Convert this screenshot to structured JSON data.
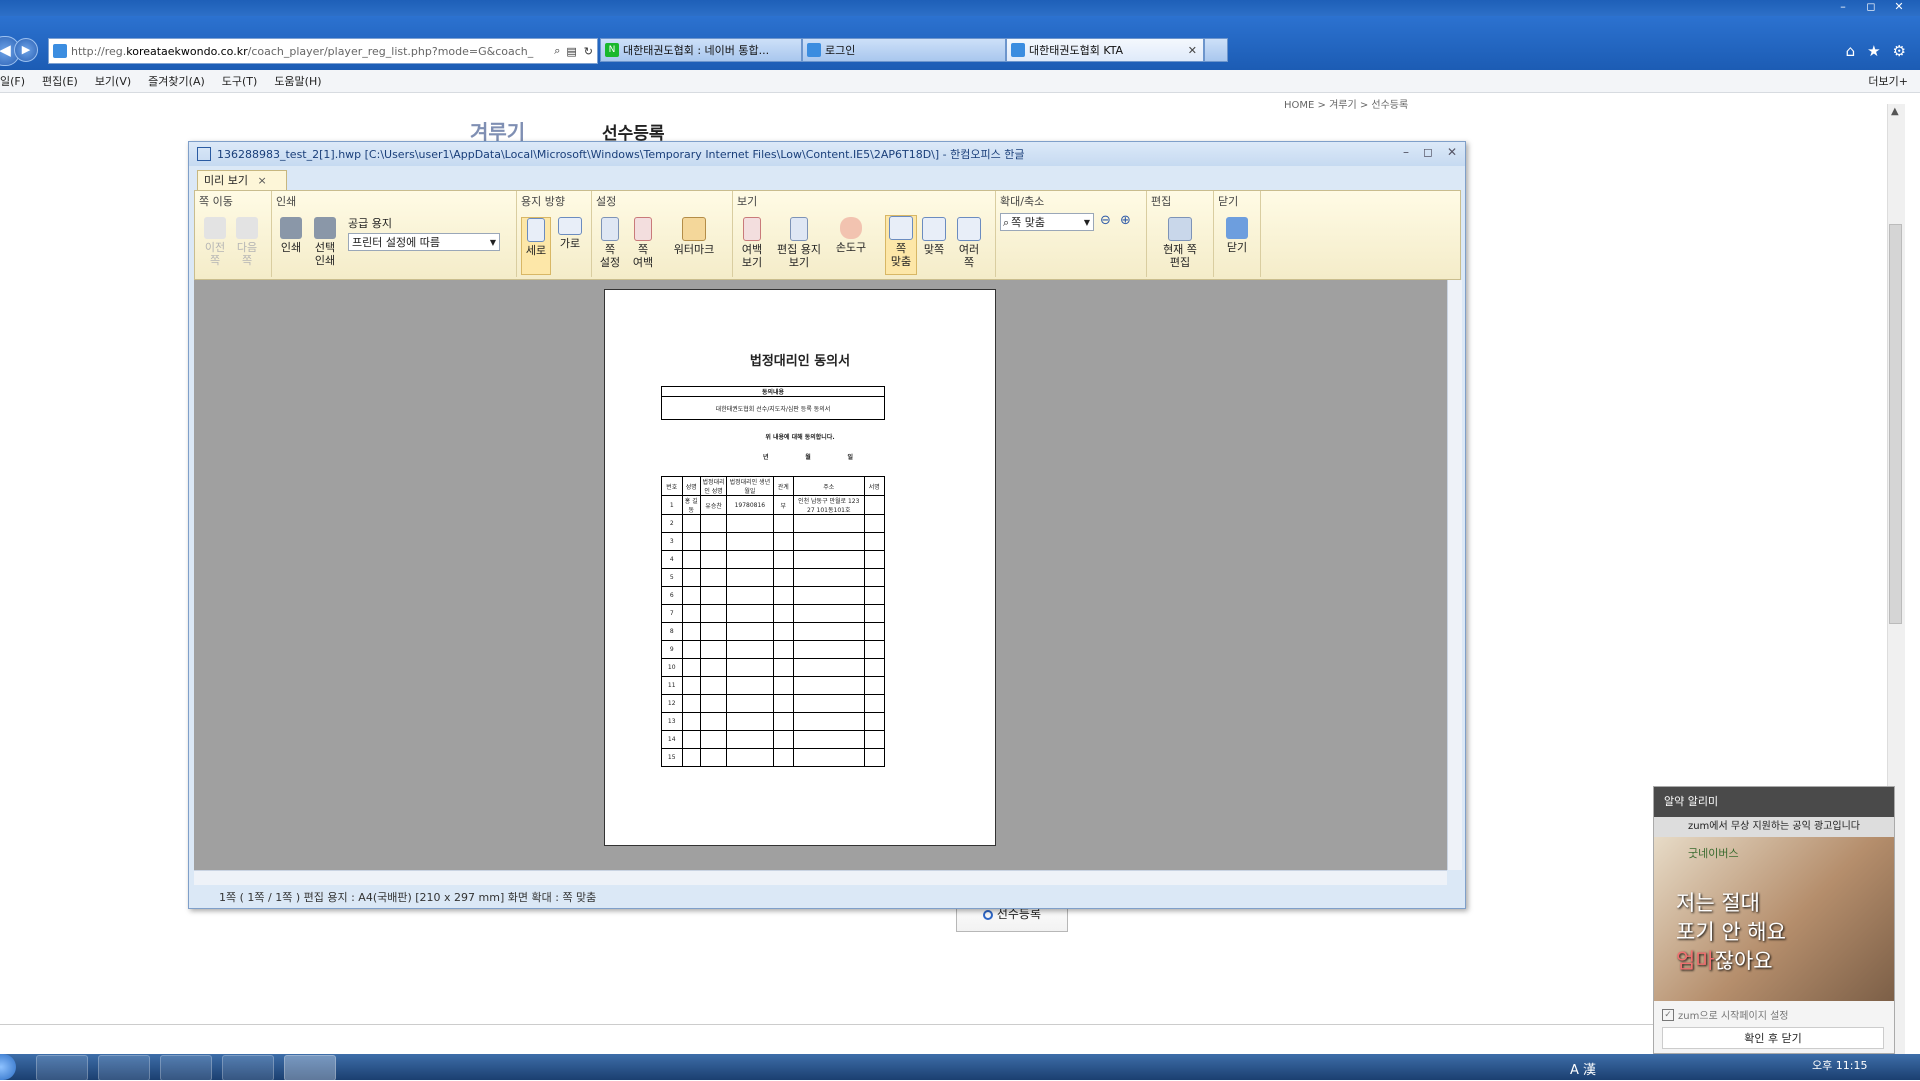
{
  "browser": {
    "window_controls": [
      "–",
      "◻",
      "✕"
    ],
    "address_prefix": "http://reg.",
    "address_domain": "koreataekwondo.co.kr",
    "address_rest": "/coach_player/player_reg_list.php?mode=G&coach_",
    "tabs": [
      {
        "label": "대한태권도협회 : 네이버 통합...",
        "active": false,
        "icon_color": "#19b82d"
      },
      {
        "label": "로그인",
        "active": false,
        "icon_color": "#3b8de0"
      },
      {
        "label": "대한태권도협회 KTA",
        "active": true,
        "icon_color": "#3b8de0",
        "close": "✕"
      }
    ],
    "menu": [
      "일(F)",
      "편집(E)",
      "보기(V)",
      "즐겨찾기(A)",
      "도구(T)",
      "도움말(H)"
    ],
    "more_label": "더보기+"
  },
  "page": {
    "breadcrumb": "HOME > 겨루기 > 선수등록",
    "section": "겨루기",
    "title": "선수등록",
    "register_button": "선수등록"
  },
  "dialog": {
    "title": "1362889​83_test_2[1].hwp [C:\\Users\\user1\\AppData\\Local\\Microsoft\\Windows\\Temporary Internet Files\\Low\\Content.IE5\\2AP6T18D\\] - 한컴오피스 한글",
    "tab_label": "미리 보기",
    "groups": {
      "page_move": "쪽 이동",
      "print": "인쇄",
      "orientation": "용지 방향",
      "settings": "설정",
      "view": "보기",
      "zoom": "확대/축소",
      "edit": "편집",
      "close": "닫기"
    },
    "buttons": {
      "prev": "이전\n쪽",
      "next": "다음\n쪽",
      "print": "인쇄",
      "select_print": "선택\n인쇄",
      "paper_label": "공급 용지",
      "paper_value": "프린터 설정에 따름",
      "portrait": "세로",
      "landscape": "가로",
      "page_setup": "쪽\n설정",
      "page_margin": "쪽\n여백",
      "watermark": "워터마크",
      "margin_view": "여백\n보기",
      "edit_paper_view": "편집 용지\n보기",
      "hand_tool": "손도구",
      "fit_page": "쪽\n맞춤",
      "fit_width": "맞쪽",
      "multi_page": "여러\n쪽",
      "zoom_value": "쪽 맞춤",
      "edit_current": "현재 쪽\n편집",
      "close": "닫기"
    },
    "status": "1쪽 ( 1쪽 / 1쪽 ) 편집 용지 : A4(국배판) [210 x 297 mm] 화면 확대 : 쪽 맞춤"
  },
  "document": {
    "title": "법정대리인 동의서",
    "box_header": "동의내용",
    "box_text": "대한태권도협회 선수/지도자/심판 등록 동의서",
    "line": "위 내용에 대해 동의합니다.",
    "date_marks": [
      "년",
      "월",
      "일"
    ],
    "table_headers": [
      "번호",
      "성명",
      "법정대리인 성명",
      "법정대리인 생년월일",
      "관계",
      "주소",
      "서명"
    ],
    "row1": [
      "1",
      "홍 길 동",
      "유승찬",
      "19780816",
      "부",
      "인천 남동구 만월로 123 27 101동101호",
      ""
    ],
    "row_numbers": [
      "2",
      "3",
      "4",
      "5",
      "6",
      "7",
      "8",
      "9",
      "10",
      "11",
      "12",
      "13",
      "14",
      "15"
    ]
  },
  "popup": {
    "header": "알약 알리미",
    "sponsor": "zum에서 무상 지원하는 공익 광고입니다",
    "brand": "굿네이버스",
    "slogan_1": "저는 절대",
    "slogan_2": "포기 안 해요",
    "slogan_3a": "엄마",
    "slogan_3b": "잖아요",
    "checkbox_label": "zum으로 시작페이지 설정",
    "confirm_button": "확인 후 닫기"
  },
  "taskbar": {
    "tray": "오후 11:15",
    "ime": "A 漢"
  }
}
